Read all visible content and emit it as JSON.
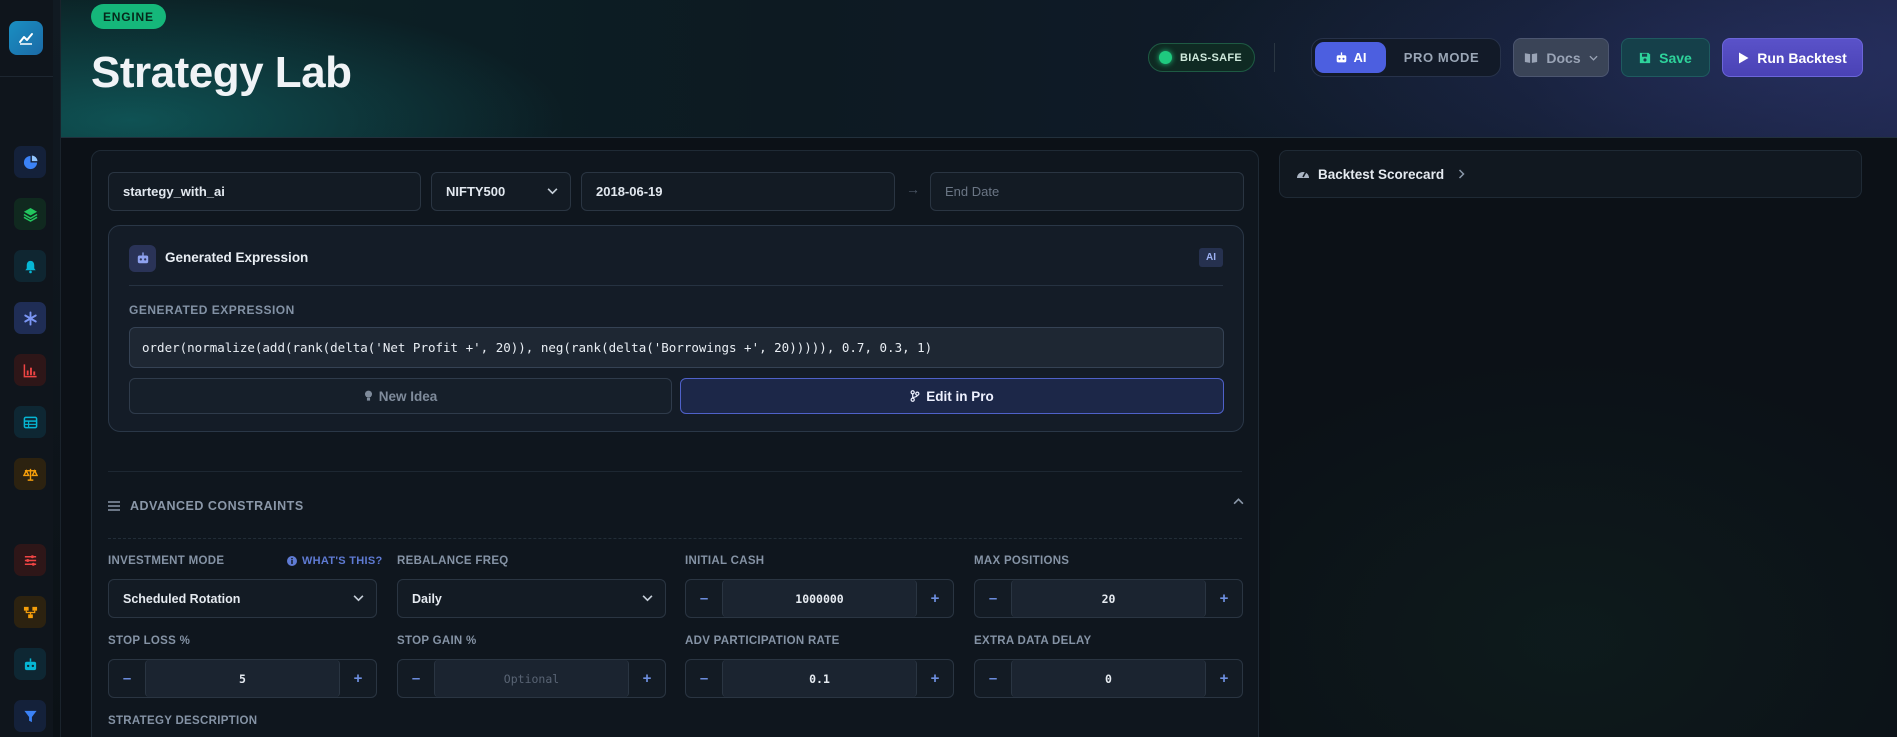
{
  "header": {
    "engine_badge": "ENGINE",
    "title": "Strategy Lab",
    "bias_label": "BIAS-SAFE",
    "mode_ai": "AI",
    "mode_pro": "PRO MODE",
    "docs_label": "Docs",
    "save_label": "Save",
    "run_label": "Run Backtest"
  },
  "sidebar": {
    "items": [
      {
        "icon": "pie-chart-icon",
        "color": "#3b82f6"
      },
      {
        "icon": "layers-icon",
        "color": "#22c55e"
      },
      {
        "icon": "bell-icon",
        "color": "#06b6d4"
      },
      {
        "icon": "asterisk-icon",
        "color": "#6d8cf0",
        "active": true
      },
      {
        "icon": "bar-chart-icon",
        "color": "#ef4444"
      },
      {
        "icon": "table-icon",
        "color": "#06b6d4"
      },
      {
        "icon": "scale-icon",
        "color": "#f59e0b"
      },
      {
        "icon": "sliders-icon",
        "color": "#ef4444"
      },
      {
        "icon": "flow-icon",
        "color": "#f59e0b"
      },
      {
        "icon": "robot-icon",
        "color": "#06b6d4"
      },
      {
        "icon": "filter-icon",
        "color": "#3b82f6"
      }
    ]
  },
  "form": {
    "strategy_name": "startegy_with_ai",
    "universe": "NIFTY500",
    "start_date": "2018-06-19",
    "end_date_placeholder": "End Date",
    "date_arrow": "→"
  },
  "expression": {
    "card_title": "Generated Expression",
    "ai_tag": "AI",
    "label": "GENERATED EXPRESSION",
    "value": "order(normalize(add(rank(delta('Net Profit +', 20)), neg(rank(delta('Borrowings +', 20))))), 0.7, 0.3, 1)",
    "new_idea_label": "New Idea",
    "edit_pro_label": "Edit in Pro"
  },
  "advanced": {
    "title": "ADVANCED CONSTRAINTS",
    "investment_mode_label": "INVESTMENT MODE",
    "whats_this": "WHAT'S THIS?",
    "investment_mode_value": "Scheduled Rotation",
    "rebalance_label": "REBALANCE FREQ",
    "rebalance_value": "Daily",
    "initial_cash_label": "INITIAL CASH",
    "initial_cash_value": "1000000",
    "max_positions_label": "MAX POSITIONS",
    "max_positions_value": "20",
    "stop_loss_label": "STOP LOSS %",
    "stop_loss_value": "5",
    "stop_gain_label": "STOP GAIN %",
    "stop_gain_placeholder": "Optional",
    "adv_label": "ADV PARTICIPATION RATE",
    "adv_value": "0.1",
    "delay_label": "EXTRA DATA DELAY",
    "delay_value": "0",
    "description_label": "STRATEGY DESCRIPTION",
    "minus": "–",
    "plus": "+"
  },
  "scorecard": {
    "title": "Backtest Scorecard"
  },
  "colors": {
    "accent": "#4c5fe0",
    "engine_badge": "#15b77a",
    "save": "#2ed39b"
  }
}
